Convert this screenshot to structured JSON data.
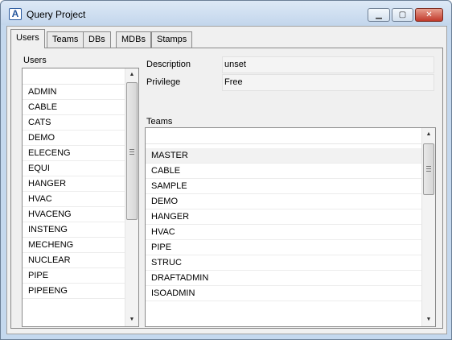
{
  "window": {
    "title": "Query Project",
    "icon": "A",
    "controls": {
      "minimize": "minimize-icon",
      "maximize": "maximize-icon",
      "close": "close-icon"
    }
  },
  "tabs": [
    {
      "label": "Users",
      "active": true
    },
    {
      "label": "Teams"
    },
    {
      "label": "DBs"
    },
    {
      "label": "MDBs"
    },
    {
      "label": "Stamps"
    }
  ],
  "users_panel": {
    "label": "Users",
    "filter_value": "",
    "items": [
      "ADMIN",
      "CABLE",
      "CATS",
      "DEMO",
      "ELECENG",
      "EQUI",
      "HANGER",
      "HVAC",
      "HVACENG",
      "INSTENG",
      "MECHENG",
      "NUCLEAR",
      "PIPE",
      "PIPEENG"
    ]
  },
  "details": {
    "description_label": "Description",
    "description_value": "unset",
    "privilege_label": "Privilege",
    "privilege_value": "Free"
  },
  "teams_panel": {
    "label": "Teams",
    "filter_value": "",
    "selected": "MASTER",
    "items": [
      "MASTER",
      "CABLE",
      "SAMPLE",
      "DEMO",
      "HANGER",
      "HVAC",
      "PIPE",
      "STRUC",
      "DRAFTADMIN",
      "ISOADMIN"
    ]
  }
}
